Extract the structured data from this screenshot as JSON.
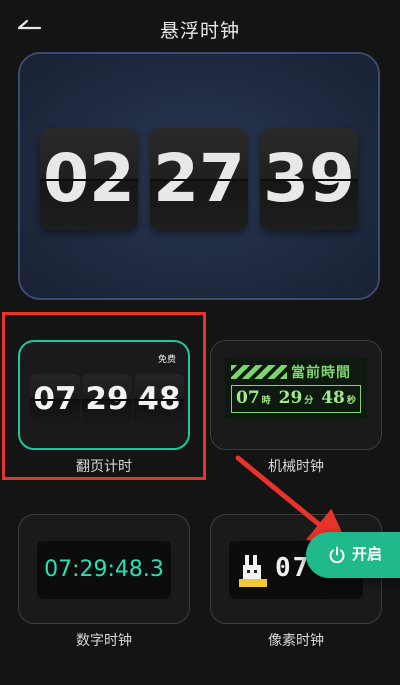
{
  "header": {
    "title": "悬浮时钟",
    "back_icon": "back-arrow-icon"
  },
  "preview": {
    "hours": "02",
    "minutes": "27",
    "seconds": "39"
  },
  "styles": [
    {
      "id": "flip",
      "label": "翻页计时",
      "hours": "07",
      "minutes": "29",
      "seconds": "48",
      "badge": "免费",
      "selected": true
    },
    {
      "id": "mechanical",
      "label": "机械时钟",
      "title": "當前時間",
      "hours": "07",
      "hour_unit": "時",
      "minutes": "29",
      "minute_unit": "分",
      "seconds": "48",
      "second_unit": "秒"
    },
    {
      "id": "digital",
      "label": "数字时钟",
      "time": "07:29:48.3"
    },
    {
      "id": "pixel",
      "label": "像素时钟",
      "time": "07"
    }
  ],
  "enable_button": {
    "label": "开启",
    "icon": "power-icon"
  },
  "colors": {
    "accent": "#1fb98b",
    "highlight": "#e8332a",
    "digital": "#28e0b4",
    "mechanical": "#7ed56f",
    "preview_bg": "#1f2a40"
  }
}
